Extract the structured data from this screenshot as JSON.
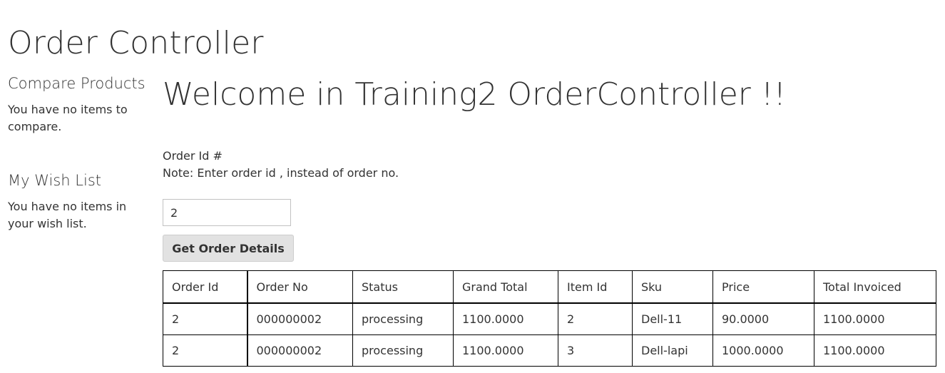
{
  "page": {
    "title": "Order Controller"
  },
  "sidebar": {
    "compare": {
      "title": "Compare Products",
      "empty_text": "You have no items to compare."
    },
    "wishlist": {
      "title": "My Wish List",
      "empty_text": "You have no items in your wish list."
    }
  },
  "main": {
    "welcome": "Welcome in Training2 OrderController !!",
    "order_label": "Order Id #",
    "note": "Note: Enter order id , instead of order no.",
    "order_input_value": "2",
    "button_label": "Get Order Details"
  },
  "table": {
    "headers": [
      "Order Id",
      "Order No",
      "Status",
      "Grand Total",
      "Item Id",
      "Sku",
      "Price",
      "Total Invoiced"
    ],
    "rows": [
      [
        "2",
        "000000002",
        "processing",
        "1100.0000",
        "2",
        "Dell-11",
        "90.0000",
        "1100.0000"
      ],
      [
        "2",
        "000000002",
        "processing",
        "1100.0000",
        "3",
        "Dell-lapi",
        "1000.0000",
        "1100.0000"
      ]
    ]
  }
}
